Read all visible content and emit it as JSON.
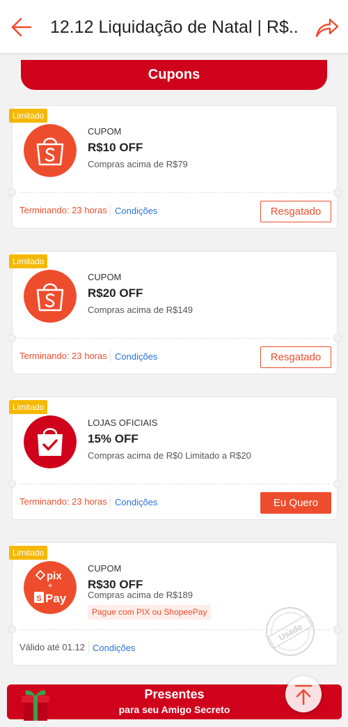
{
  "header": {
    "title": "12.12 Liquidação de Natal | R$.."
  },
  "banner": {
    "label": "Cupons"
  },
  "coupons": [
    {
      "tag": "Limitado",
      "type": "CUPOM",
      "amount": "R$10 OFF",
      "condition": "Compras acima de R$79",
      "expire": "Terminando: 23 horas",
      "terms": "Condições",
      "button": "Resgatado",
      "logo": "shopee-bag-icon"
    },
    {
      "tag": "Limitado",
      "type": "CUPOM",
      "amount": "R$20 OFF",
      "condition": "Compras acima de R$149",
      "expire": "Terminando: 23 horas",
      "terms": "Condições",
      "button": "Resgatado",
      "logo": "shopee-bag-icon"
    },
    {
      "tag": "Limitado",
      "type": "LOJAS OFICIAIS",
      "amount": "15% OFF",
      "condition": "Compras acima de R$0 Limitado a R$20",
      "expire": "Terminando: 23 horas",
      "terms": "Condições",
      "button": "Eu Quero",
      "logo": "official-store-check-bag-icon"
    },
    {
      "tag": "Limitado",
      "type": "CUPOM",
      "amount": "R$30 OFF",
      "condition": "Compras acima de R$189",
      "payment": "Pague com PIX ou ShopeePay",
      "expire": "Válido até 01.12",
      "terms": "Condições",
      "logo": "pix-shopeepay-icon",
      "logo_text": {
        "pix": "pix",
        "plus": "+",
        "pay": "Pay",
        "s": "S"
      },
      "stamp": "Usado"
    }
  ],
  "bottom_banner": {
    "line1": "Presentes",
    "line2": "para seu  Amigo Secreto"
  },
  "colors": {
    "brand": "#ee4d2d",
    "banner": "#d0011b",
    "tag": "#f5b800",
    "link": "#2673dd"
  }
}
